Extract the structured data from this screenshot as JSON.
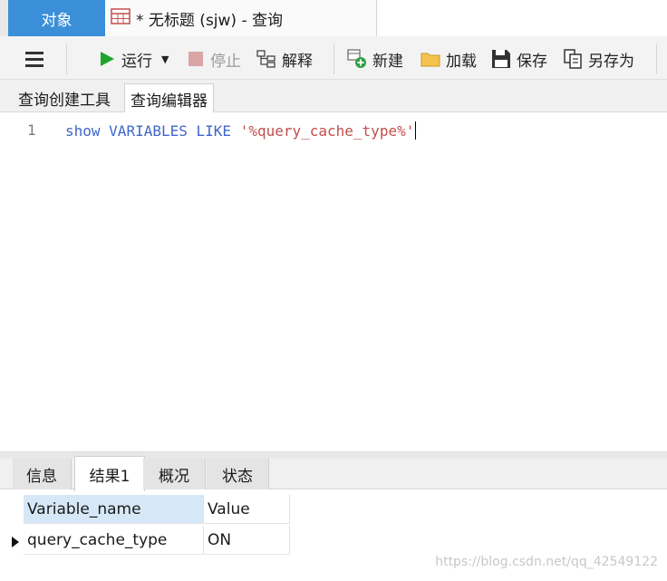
{
  "tabs": {
    "objects_label": "对象",
    "query_label": "* 无标题 (sjw) - 查询"
  },
  "toolbar": {
    "run_label": "运行",
    "stop_label": "停止",
    "explain_label": "解释",
    "new_label": "新建",
    "load_label": "加载",
    "save_label": "保存",
    "save_as_label": "另存为"
  },
  "subtabs": {
    "builder_label": "查询创建工具",
    "editor_label": "查询编辑器"
  },
  "editor": {
    "line_number": "1",
    "code_kw1": "show",
    "code_kw2": "VARIABLES",
    "code_kw3": "LIKE",
    "code_string": "'%query_cache_type%'"
  },
  "result_tabs": {
    "info_label": "信息",
    "result_label": "结果1",
    "overview_label": "概况",
    "status_label": "状态"
  },
  "grid": {
    "columns": [
      "Variable_name",
      "Value"
    ],
    "rows": [
      [
        "query_cache_type",
        "ON"
      ]
    ]
  },
  "watermark": "https://blog.csdn.net/qq_42549122",
  "colors": {
    "accent": "#3a8fd8",
    "keyword": "#3f66c9",
    "string": "#c0504d",
    "run_green": "#1fa52a"
  }
}
